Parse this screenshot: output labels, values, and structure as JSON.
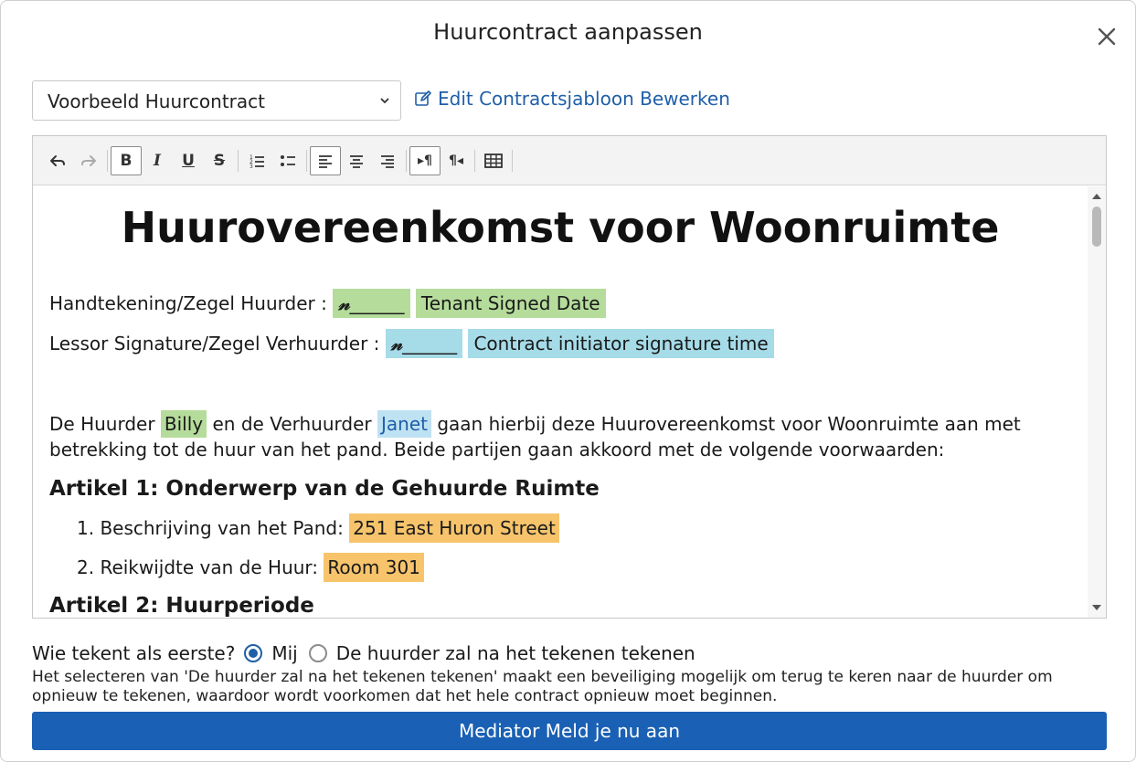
{
  "dialog": {
    "title": "Huurcontract aanpassen"
  },
  "template": {
    "selected": "Voorbeeld Huurcontract",
    "edit_link": "Edit Contractsjabloon Bewerken"
  },
  "toolbar": {
    "buttons": [
      "undo-icon",
      "redo-icon",
      "bold-icon",
      "italic-icon",
      "underline-icon",
      "strikethrough-icon",
      "numbered-list-icon",
      "bulleted-list-icon",
      "align-left-icon",
      "align-center-icon",
      "align-right-icon",
      "ltr-icon",
      "rtl-icon",
      "table-icon"
    ]
  },
  "document": {
    "title": "Huurovereenkomst voor Woonruimte",
    "tenant_sig_label": "Handtekening/Zegel Huurder :",
    "tenant_sig_field": "______",
    "tenant_date_field": "Tenant Signed Date",
    "lessor_sig_label": "Lessor Signature/Zegel Verhuurder :",
    "lessor_sig_field": "______",
    "lessor_time_field": "Contract initiator signature time",
    "intro_p1": "De Huurder",
    "tenant_name": "Billy",
    "intro_p2": "en de Verhuurder",
    "landlord_name": "Janet",
    "intro_p3": "gaan hierbij deze Huurovereenkomst voor Woonruimte aan met betrekking tot de huur van het pand. Beide partijen gaan akkoord met de volgende voorwaarden:",
    "article1": "Artikel 1: Onderwerp van de Gehuurde Ruimte",
    "item1_label": "1. Beschrijving van het Pand:",
    "item1_value": "251 East Huron Street",
    "item2_label": "2. Reikwijdte van de Huur:",
    "item2_value": "Room 301",
    "article2": "Artikel 2: Huurperiode"
  },
  "signing": {
    "question": "Wie tekent als eerste?",
    "option_me": "Mij",
    "option_tenant": "De huurder zal na het tekenen tekenen",
    "note": "Het selecteren van 'De huurder zal na het tekenen tekenen' maakt een beveiliging mogelijk om terug te keren naar de huurder om opnieuw te tekenen, waardoor wordt voorkomen dat het hele contract opnieuw moet beginnen."
  },
  "submit": {
    "label": "Mediator Meld je nu aan"
  },
  "colors": {
    "primary": "#1a60b4",
    "link": "#1f5fa8",
    "highlight_green": "#b5dc9b",
    "highlight_blue": "#a6dbe8",
    "highlight_orange": "#f7c46c"
  }
}
